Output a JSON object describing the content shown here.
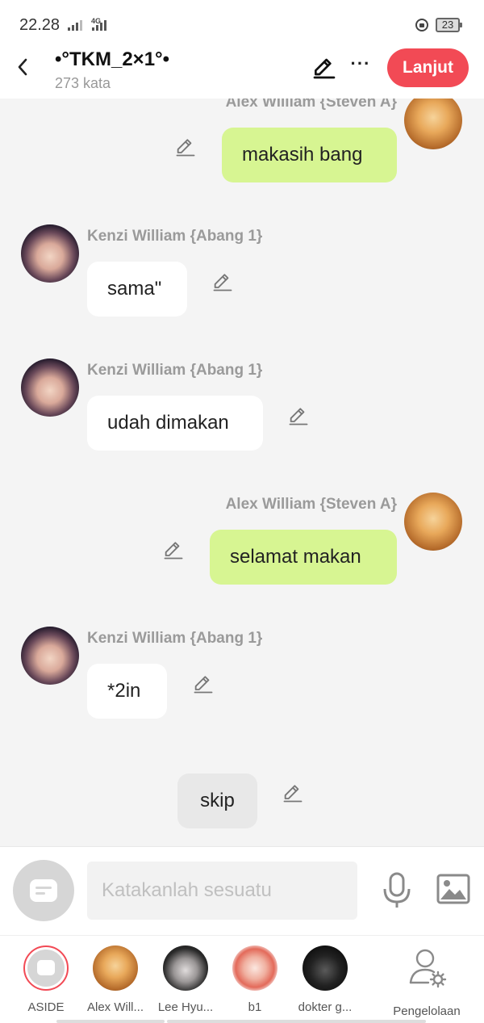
{
  "status": {
    "time": "22.28",
    "network": "4G",
    "battery": "23"
  },
  "header": {
    "title": "•°TKM_2×1°•",
    "subtitle": "273 kata",
    "next_label": "Lanjut"
  },
  "messages": [
    {
      "speaker": "Alex William {Steven A}",
      "text": "makasih bang"
    },
    {
      "speaker": "Kenzi William {Abang 1}",
      "text": "sama\""
    },
    {
      "speaker": "Kenzi William {Abang 1}",
      "text": "udah dimakan"
    },
    {
      "speaker": "Alex William {Steven A}",
      "text": "selamat makan"
    },
    {
      "speaker": "Kenzi William {Abang 1}",
      "text": "*2in"
    },
    {
      "speaker": "",
      "text": "skip"
    }
  ],
  "input": {
    "placeholder": "Katakanlah sesuatu"
  },
  "characters": [
    {
      "label": "ASIDE"
    },
    {
      "label": "Alex Will..."
    },
    {
      "label": "Lee Hyu..."
    },
    {
      "label": "b1"
    },
    {
      "label": "dokter g..."
    },
    {
      "label": "Pengelolaan"
    }
  ],
  "colors": {
    "accent": "#f24a55",
    "bubble_right": "#d7f592",
    "bubble_left": "#ffffff",
    "background": "#f4f4f4"
  }
}
